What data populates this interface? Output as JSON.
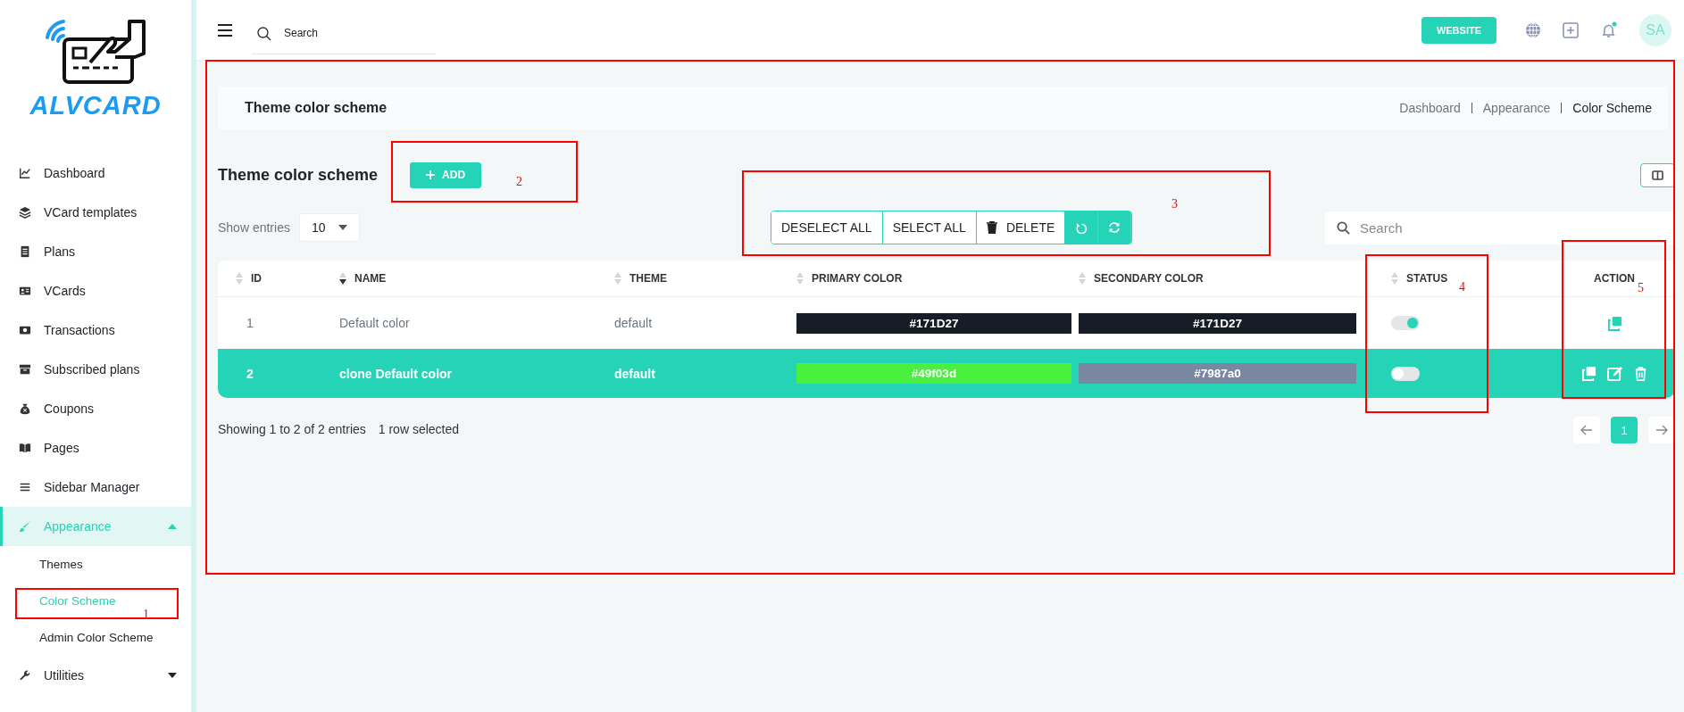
{
  "sidebar": {
    "logo_text": "ALVCARD",
    "items": [
      {
        "kind": "link",
        "label": "Dashboard",
        "selected": false
      },
      {
        "kind": "link",
        "label": "VCard templates",
        "selected": false
      },
      {
        "kind": "link",
        "label": "Plans",
        "selected": false
      },
      {
        "kind": "link",
        "label": "VCards",
        "selected": false
      },
      {
        "kind": "link",
        "label": "Transactions",
        "selected": false
      },
      {
        "kind": "link",
        "label": "Subscribed plans",
        "selected": false
      },
      {
        "kind": "link",
        "label": "Coupons",
        "selected": false
      },
      {
        "kind": "link",
        "label": "Pages",
        "selected": false
      },
      {
        "kind": "link",
        "label": "Sidebar Manager",
        "selected": false
      },
      {
        "kind": "group",
        "label": "Appearance",
        "selected": true,
        "expanded": true,
        "children": [
          {
            "label": "Themes",
            "selected": false
          },
          {
            "label": "Color Scheme",
            "selected": true
          },
          {
            "label": "Admin Color Scheme",
            "selected": false
          }
        ]
      },
      {
        "kind": "group",
        "label": "Utilities",
        "selected": false,
        "expanded": false
      }
    ]
  },
  "topbar": {
    "search": {
      "placeholder": "Search"
    },
    "website_button": "WEBSITE",
    "has_notification": true,
    "avatar_initials": "SA"
  },
  "page": {
    "title": "Theme color scheme",
    "breadcrumbs": [
      {
        "label": "Dashboard",
        "selected": false
      },
      {
        "label": "Appearance",
        "selected": false
      },
      {
        "label": "Color Scheme",
        "selected": true
      }
    ],
    "heading": "Theme color scheme",
    "add_button": "ADD",
    "show_entries": {
      "label": "Show entries",
      "value": "10"
    },
    "toolbar": [
      {
        "kind": "text",
        "label": "DESELECT ALL"
      },
      {
        "kind": "text",
        "label": "SELECT ALL"
      },
      {
        "kind": "delete",
        "label": "DELETE"
      },
      {
        "kind": "reload"
      },
      {
        "kind": "sync"
      }
    ],
    "search": {
      "placeholder": "Search"
    }
  },
  "table": {
    "columns": [
      {
        "label": "ID",
        "sortable": true,
        "sorted_desc": false
      },
      {
        "label": "NAME",
        "sortable": true,
        "sorted_desc": true
      },
      {
        "label": "THEME",
        "sortable": true,
        "sorted_desc": false
      },
      {
        "label": "PRIMARY COLOR",
        "sortable": true,
        "sorted_desc": false
      },
      {
        "label": "SECONDARY COLOR",
        "sortable": true,
        "sorted_desc": false
      },
      {
        "label": "STATUS",
        "sortable": true,
        "sorted_desc": false
      },
      {
        "label": "ACTION",
        "sortable": false
      }
    ],
    "rows": [
      {
        "id": "1",
        "name": "Default color",
        "theme": "default",
        "primary_color": {
          "text": "#171D27",
          "color": "#171d27"
        },
        "secondary_color": {
          "text": "#171D27",
          "color": "#171d27"
        },
        "status_on": true,
        "selected": false,
        "actions": [
          {
            "kind": "copy"
          }
        ]
      },
      {
        "id": "2",
        "name": "clone Default color",
        "theme": "default",
        "primary_color": {
          "text": "#49f03d",
          "color": "#49f03d"
        },
        "secondary_color": {
          "text": "#7987a0",
          "color": "#7987a0"
        },
        "status_on": false,
        "selected": true,
        "actions": [
          {
            "kind": "copy"
          },
          {
            "kind": "edit"
          },
          {
            "kind": "delete"
          }
        ]
      }
    ],
    "info": "Showing 1 to 2 of 2 entries",
    "selection_info": "1 row selected",
    "pagination": [
      {
        "kind": "prev"
      },
      {
        "kind": "page",
        "label": "1",
        "selected": true
      },
      {
        "kind": "next"
      }
    ]
  },
  "annotations": [
    {
      "kind": "frame"
    },
    {
      "kind": "numbered",
      "number": "1"
    },
    {
      "kind": "numbered",
      "number": "2"
    },
    {
      "kind": "numbered",
      "number": "3"
    },
    {
      "kind": "numbered",
      "number": "4"
    },
    {
      "kind": "numbered",
      "number": "5"
    }
  ]
}
